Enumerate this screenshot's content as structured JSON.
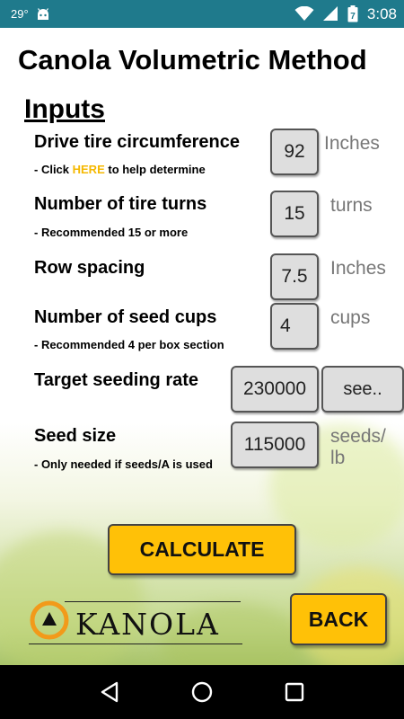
{
  "status_bar": {
    "temperature": "29°",
    "time": "3:08",
    "battery_level": "7"
  },
  "app": {
    "title": "Canola Volumetric Method",
    "section_title": "Inputs"
  },
  "rows": {
    "tire_circumference": {
      "label": "Drive tire circumference",
      "hint_prefix": "- Click ",
      "hint_link": "HERE",
      "hint_suffix": " to help determine",
      "value": "92",
      "unit": "Inches"
    },
    "tire_turns": {
      "label": "Number of tire turns",
      "hint": "- Recommended 15 or more",
      "value": "15",
      "unit": "turns"
    },
    "row_spacing": {
      "label": "Row spacing",
      "value": "7.5",
      "unit": "Inches"
    },
    "seed_cups": {
      "label": "Number of seed cups",
      "hint": "- Recommended 4 per box section",
      "value": "4",
      "unit": "cups"
    },
    "seeding_rate": {
      "label": "Target seeding rate",
      "value": "230000",
      "unit_select": "see.."
    },
    "seed_size": {
      "label": "Seed size",
      "hint": "- Only needed if seeds/A is used",
      "value": "115000",
      "unit_line1": "seeds/",
      "unit_line2": "lb"
    }
  },
  "buttons": {
    "calculate": "CALCULATE",
    "back": "BACK"
  },
  "logo": {
    "text": "KANOLA"
  },
  "colors": {
    "accent": "#ffc107",
    "status_bar": "#1f7a8c",
    "field_bg": "#dedede",
    "link": "#f5b800"
  },
  "icons": [
    "android-icon",
    "wifi-icon",
    "cell-signal-icon",
    "battery-icon",
    "back-nav-icon",
    "home-nav-icon",
    "recents-nav-icon"
  ]
}
